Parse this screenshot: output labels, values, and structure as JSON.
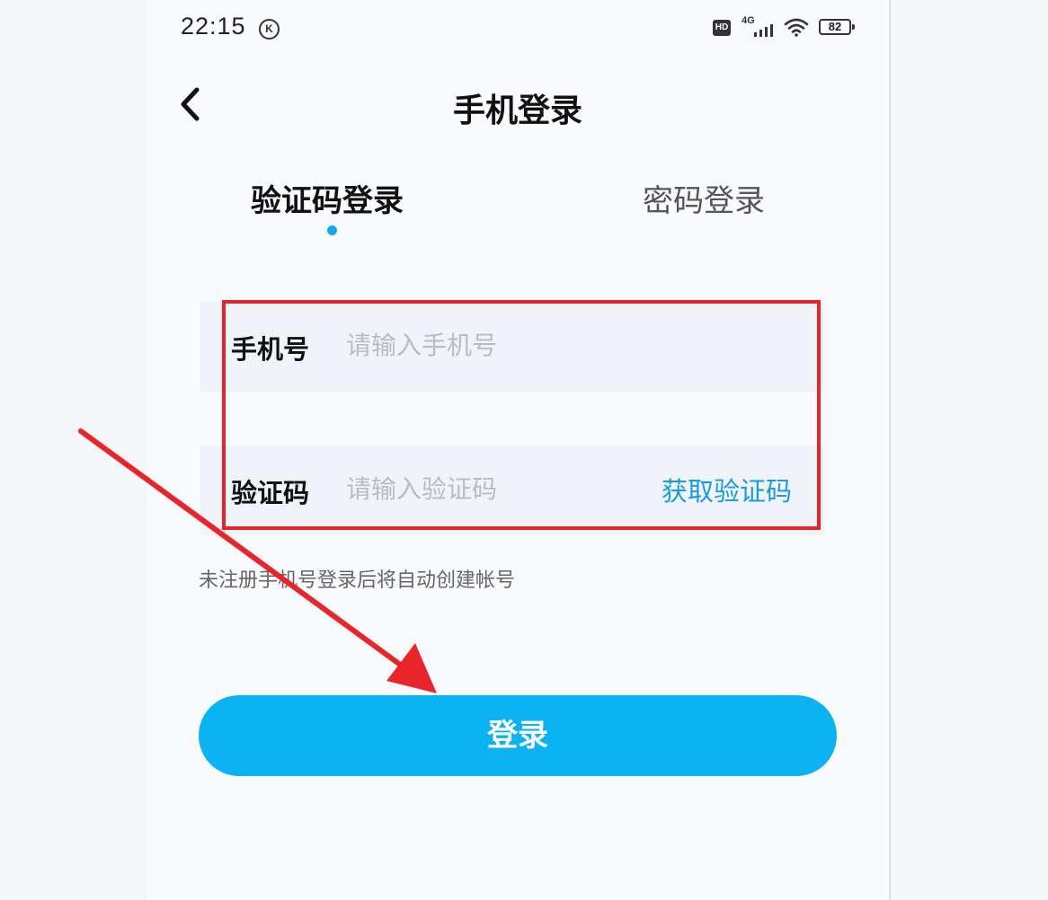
{
  "status_bar": {
    "time": "22:15",
    "k_badge": "K",
    "hd_badge": "HD",
    "network": "4G",
    "battery": "82"
  },
  "header": {
    "back_icon": "chevron-left-icon",
    "title": "手机登录"
  },
  "tabs": [
    {
      "label": "验证码登录",
      "active": true
    },
    {
      "label": "密码登录",
      "active": false
    }
  ],
  "form": {
    "phone": {
      "label": "手机号",
      "placeholder": "请输入手机号",
      "value": ""
    },
    "code": {
      "label": "验证码",
      "placeholder": "请输入验证码",
      "value": ""
    },
    "get_code_label": "获取验证码"
  },
  "hint": "未注册手机号登录后将自动创建帐号",
  "login_label": "登录",
  "colors": {
    "accent": "#0cb3f2",
    "link": "#1a9be0",
    "annotation": "#e8252b"
  }
}
